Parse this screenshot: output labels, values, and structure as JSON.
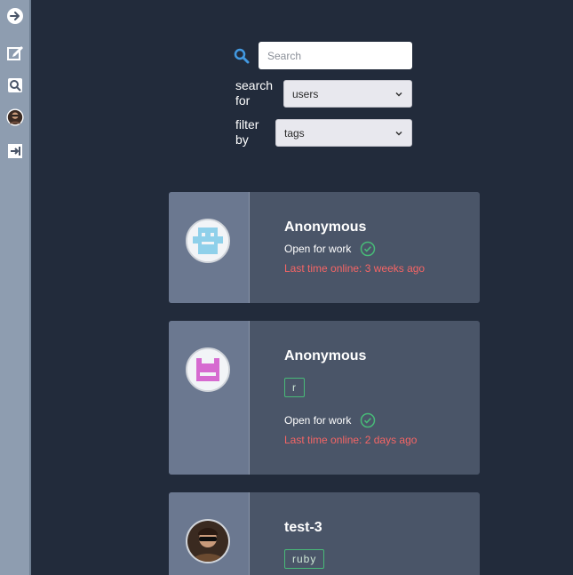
{
  "sidebar": {
    "items": [
      {
        "icon": "arrow-right-circle-icon"
      },
      {
        "icon": "edit-icon"
      },
      {
        "icon": "search-document-icon"
      },
      {
        "icon": "profile-avatar-icon"
      },
      {
        "icon": "logout-icon"
      }
    ]
  },
  "search": {
    "placeholder": "Search",
    "value": "",
    "search_for_label": "search for",
    "search_for_value": "users",
    "filter_by_label": "filter by",
    "filter_by_value": "tags"
  },
  "users": [
    {
      "name": "Anonymous",
      "avatar": "robot-face-blue",
      "tags": [],
      "status": "Open for work",
      "last_online": "Last time online: 3 weeks ago"
    },
    {
      "name": "Anonymous",
      "avatar": "robot-face-pink",
      "tags": [
        "r"
      ],
      "status": "Open for work",
      "last_online": "Last time online: 2 days ago"
    },
    {
      "name": "test-3",
      "avatar": "photo-person-sunglasses",
      "tags": [
        "ruby"
      ],
      "status": "",
      "last_online": ""
    }
  ],
  "colors": {
    "background": "#222b3b",
    "sidebar": "#8e9db0",
    "card": "#4a5568",
    "card_left": "#6b7890",
    "accent_blue": "#4299e1",
    "success_green": "#48bb78",
    "danger_red": "#f56565"
  }
}
